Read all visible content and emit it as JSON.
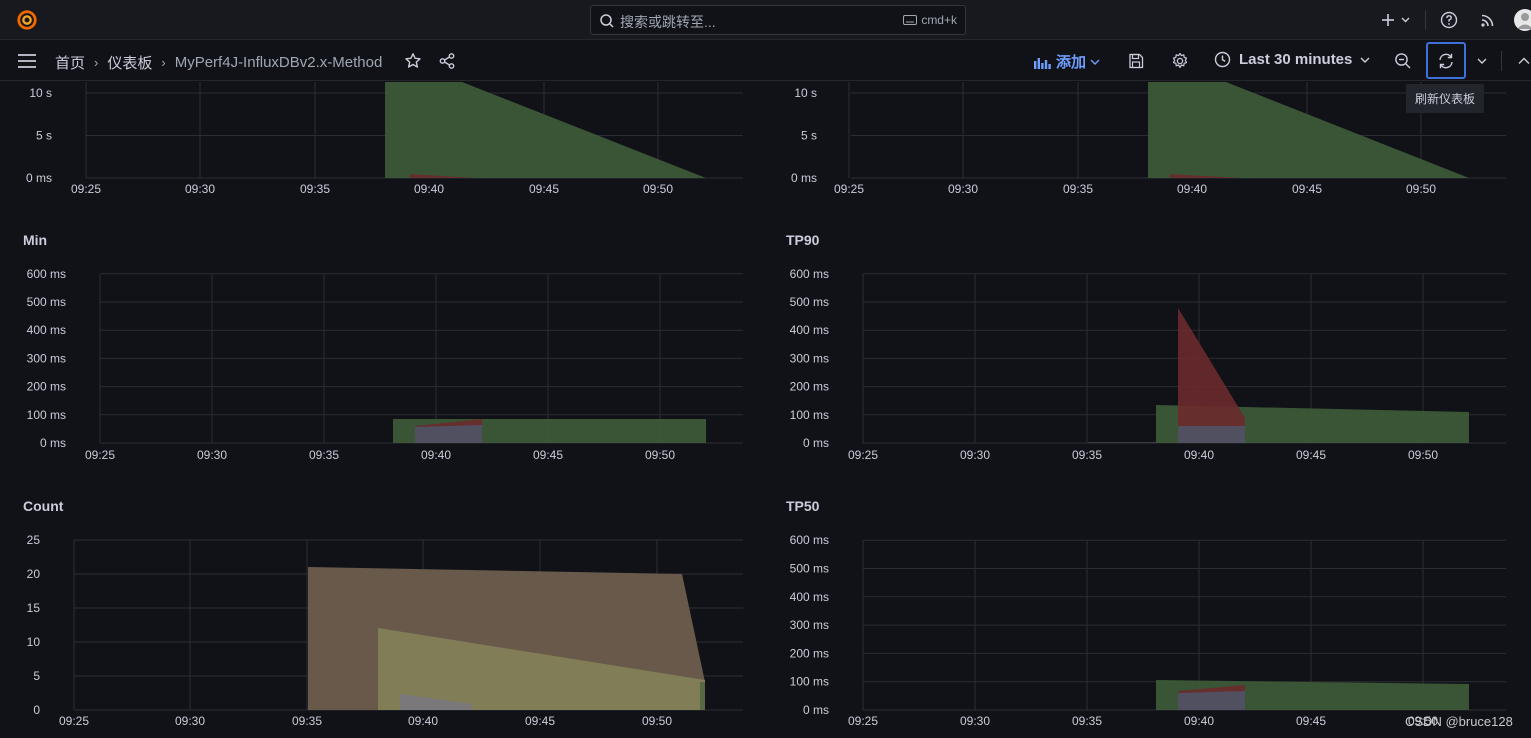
{
  "topbar": {
    "search_placeholder": "搜索或跳转至...",
    "shortcut": "cmd+k",
    "icons": [
      "grafana-logo-icon",
      "plus-icon",
      "help-icon",
      "rss-icon",
      "avatar"
    ]
  },
  "navbar": {
    "breadcrumbs": [
      "首页",
      "仪表板",
      "MyPerf4J-InfluxDBv2.x-Method"
    ],
    "add_label": "添加",
    "time_range": "Last 30 minutes",
    "refresh_tooltip": "刷新仪表板"
  },
  "colors": {
    "green": "#3c5a37",
    "red": "#6b2a2c",
    "blue_gray": "#4e5466",
    "tan": "#6b5c4c",
    "khaki": "#827f58",
    "accent": "#3d71d9"
  },
  "panels": [
    {
      "id": "top-left",
      "title": "",
      "y_ticks": [
        "0 ms",
        "5 s",
        "10 s"
      ],
      "x_ticks": [
        "09:25",
        "09:30",
        "09:35",
        "09:40",
        "09:45",
        "09:50"
      ]
    },
    {
      "id": "top-right",
      "title": "",
      "y_ticks": [
        "0 ms",
        "5 s",
        "10 s"
      ],
      "x_ticks": [
        "09:25",
        "09:30",
        "09:35",
        "09:40",
        "09:45",
        "09:50"
      ]
    },
    {
      "id": "min",
      "title": "Min",
      "y_ticks": [
        "0 ms",
        "100 ms",
        "200 ms",
        "300 ms",
        "400 ms",
        "500 ms",
        "600 ms"
      ],
      "x_ticks": [
        "09:25",
        "09:30",
        "09:35",
        "09:40",
        "09:45",
        "09:50"
      ]
    },
    {
      "id": "tp90",
      "title": "TP90",
      "y_ticks": [
        "0 ms",
        "100 ms",
        "200 ms",
        "300 ms",
        "400 ms",
        "500 ms",
        "600 ms"
      ],
      "x_ticks": [
        "09:25",
        "09:30",
        "09:35",
        "09:40",
        "09:45",
        "09:50"
      ]
    },
    {
      "id": "count",
      "title": "Count",
      "y_ticks": [
        "0",
        "5",
        "10",
        "15",
        "20",
        "25"
      ],
      "x_ticks": [
        "09:25",
        "09:30",
        "09:35",
        "09:40",
        "09:45",
        "09:50"
      ]
    },
    {
      "id": "tp50",
      "title": "TP50",
      "y_ticks": [
        "0 ms",
        "100 ms",
        "200 ms",
        "300 ms",
        "400 ms",
        "500 ms",
        "600 ms"
      ],
      "x_ticks": [
        "09:25",
        "09:30",
        "09:35",
        "09:40",
        "09:45",
        "09:50"
      ]
    }
  ],
  "watermark": "CSDN @bruce128"
}
